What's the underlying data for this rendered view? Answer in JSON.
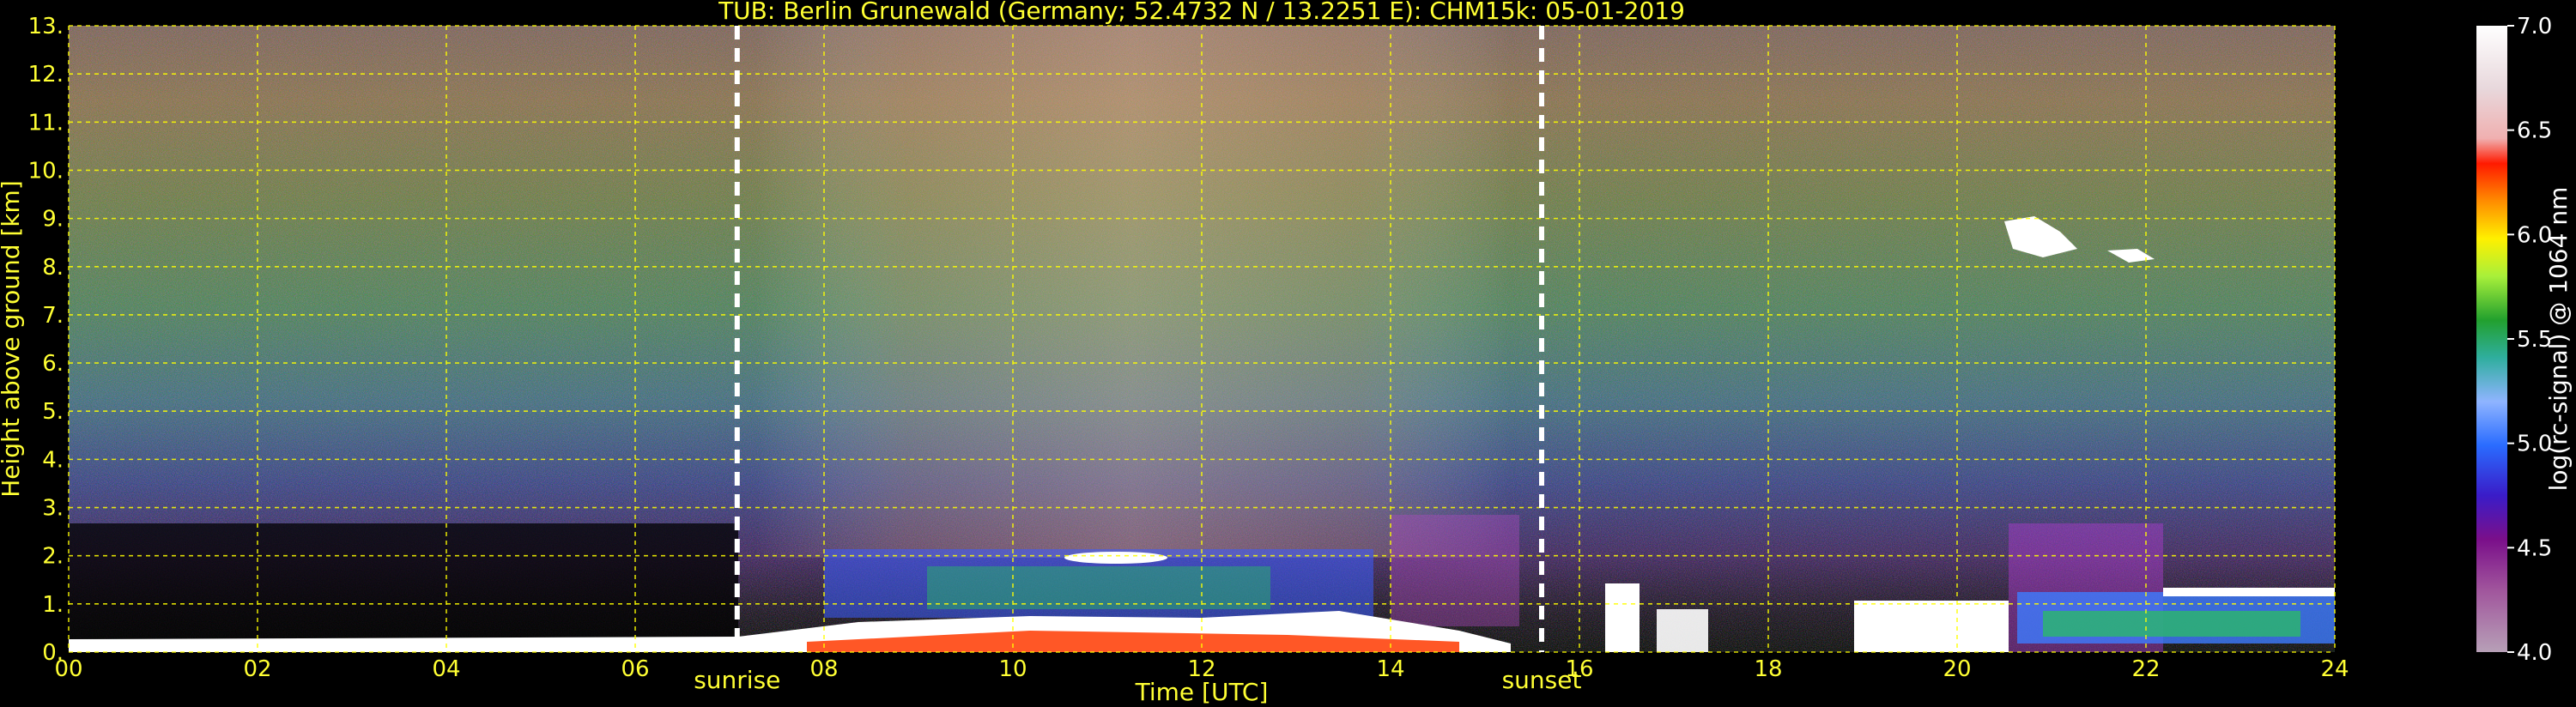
{
  "title": "TUB: Berlin Grunewald (Germany; 52.4732 N / 13.2251 E):    CHM15k: 05-01-2019",
  "chart_data": {
    "type": "heatmap",
    "title": "TUB: Berlin Grunewald (Germany; 52.4732 N / 13.2251 E):    CHM15k: 05-01-2019",
    "xlabel": "Time [UTC]",
    "ylabel": "Height above ground [km]",
    "xlim": [
      0,
      24
    ],
    "ylim": [
      0,
      13
    ],
    "x_ticks": [
      "00",
      "02",
      "04",
      "06",
      "08",
      "10",
      "12",
      "14",
      "16",
      "18",
      "20",
      "22",
      "24"
    ],
    "y_ticks": [
      "0.",
      "1.",
      "2.",
      "3.",
      "4.",
      "5.",
      "6.",
      "7.",
      "8.",
      "9.",
      "10.",
      "11.",
      "12.",
      "13."
    ],
    "grid": true,
    "colorbar": {
      "label": "log(rc-signal) @ 1064 nm",
      "range": [
        4.0,
        7.0
      ],
      "ticks": [
        "4.0",
        "4.5",
        "5.0",
        "5.5",
        "6.0",
        "6.5",
        "7.0"
      ]
    },
    "markers": [
      {
        "label": "sunrise",
        "x": 7.08
      },
      {
        "label": "sunset",
        "x": 15.6
      }
    ]
  },
  "colors": {
    "axis_text": "#ffff33",
    "grid": "#ffff00",
    "background": "#000000"
  }
}
